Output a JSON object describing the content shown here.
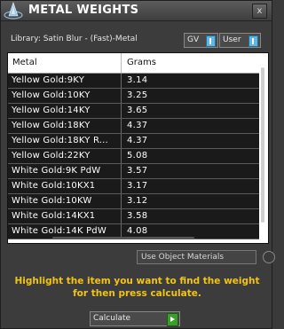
{
  "window": {
    "title": "METAL WEIGHTS",
    "close_glyph": "x"
  },
  "library": {
    "label": "Library: Satin Blur - (Fast)-Metal"
  },
  "toggles": [
    {
      "label": "GV"
    },
    {
      "label": "User"
    }
  ],
  "table": {
    "columns": [
      "Metal",
      "Grams"
    ],
    "rows": [
      {
        "metal": "Yellow Gold:9KY",
        "grams": "3.14"
      },
      {
        "metal": "Yellow Gold:10KY",
        "grams": "3.25"
      },
      {
        "metal": "Yellow Gold:14KY",
        "grams": "3.65"
      },
      {
        "metal": "Yellow Gold:18KY",
        "grams": "4.37"
      },
      {
        "metal": "Yellow Gold:18KY R...",
        "grams": "4.37"
      },
      {
        "metal": "Yellow Gold:22KY",
        "grams": "5.08"
      },
      {
        "metal": "White Gold:9K PdW",
        "grams": "3.57"
      },
      {
        "metal": "White Gold:10KX1",
        "grams": "3.17"
      },
      {
        "metal": "White Gold:10KW",
        "grams": "3.12"
      },
      {
        "metal": "White Gold:14KX1",
        "grams": "3.58"
      },
      {
        "metal": "White Gold:14K PdW",
        "grams": "4.08"
      }
    ]
  },
  "use_object_materials": {
    "label": "Use Object Materials"
  },
  "help_text": {
    "line1": "Highlight the item you want to find the weight",
    "line2": "for then press calculate."
  },
  "calculate": {
    "label": "Calculate"
  },
  "colors": {
    "accent": "#f2c418",
    "toggle_on": "#5fb7e6",
    "go": "#3c9c2c"
  }
}
